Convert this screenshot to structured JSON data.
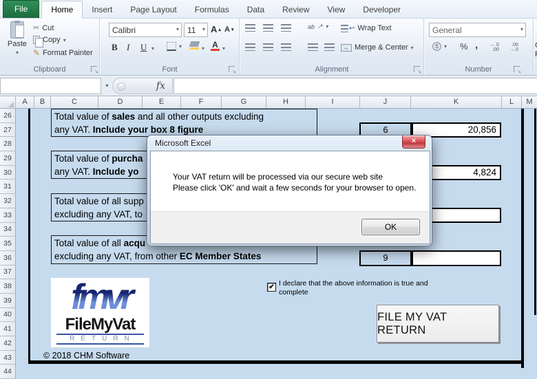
{
  "ribbon": {
    "tabs": [
      {
        "label": "File"
      },
      {
        "label": "Home"
      },
      {
        "label": "Insert"
      },
      {
        "label": "Page Layout"
      },
      {
        "label": "Formulas"
      },
      {
        "label": "Data"
      },
      {
        "label": "Review"
      },
      {
        "label": "View"
      },
      {
        "label": "Developer"
      }
    ],
    "clipboard": {
      "group_label": "Clipboard",
      "paste": "Paste",
      "cut": "Cut",
      "copy": "Copy",
      "format_painter": "Format Painter"
    },
    "font": {
      "group_label": "Font",
      "font_name": "Calibri",
      "font_size": "11",
      "bold": "B",
      "italic": "I",
      "underline": "U",
      "grow": "A",
      "shrink": "A",
      "font_color_letter": "A"
    },
    "alignment": {
      "group_label": "Alignment",
      "wrap_text": "Wrap Text",
      "merge_center": "Merge & Center",
      "orientation": "ab"
    },
    "number": {
      "group_label": "Number",
      "format": "General",
      "percent": "%",
      "comma": ",",
      "inc1": "←.0",
      "inc2": ".00",
      "dec1": ".00",
      "dec2": "→.0"
    },
    "styles_clipped_line1": "Co",
    "styles_clipped_line2": "Fo"
  },
  "icons": {
    "dropdown": "▾",
    "up_arrow": "▴",
    "scissors": "✂",
    "brush": "✎",
    "orient_arrow": "↗",
    "wrap_arrow": "↩",
    "merge_arrows": "↔",
    "launcher_arrow": "↘",
    "check": "✔",
    "close": "×",
    "fx": "fx",
    "currency": "$"
  },
  "formula_bar": {
    "name_box": ""
  },
  "grid": {
    "columns": [
      "A",
      "B",
      "C",
      "D",
      "E",
      "F",
      "G",
      "H",
      "I",
      "J",
      "K",
      "L",
      "M"
    ],
    "rows": [
      "26",
      "27",
      "28",
      "29",
      "30",
      "31",
      "32",
      "33",
      "34",
      "35",
      "36",
      "37",
      "38",
      "39",
      "40",
      "41",
      "42",
      "43",
      "44"
    ]
  },
  "form": {
    "boxes": [
      {
        "line1_pre": "Total value of ",
        "line1_bold": "sales",
        "line1_post": " and all other outputs excluding",
        "line2_pre": "any VAT. ",
        "line2_bold": "Include your box 8 figure",
        "line2_post": "",
        "box_no": "6",
        "value": "20,856"
      },
      {
        "line1_pre": "Total value of ",
        "line1_bold": "purcha",
        "line1_post": "",
        "line2_pre": "any VAT. ",
        "line2_bold": "Include yo",
        "line2_post": "",
        "box_no": "",
        "value": "4,824"
      },
      {
        "line1_pre": "Total value of all supp",
        "line1_bold": "",
        "line1_post": "",
        "line2_pre": "excluding any VAT, to",
        "line2_bold": "",
        "line2_post": "",
        "box_no": "",
        "value": ""
      },
      {
        "line1_pre": "Total value of all ",
        "line1_bold": "acqu",
        "line1_post": "",
        "line2_pre": "excluding any VAT, from other ",
        "line2_bold": "EC Member States",
        "line2_post": "",
        "box_no": "9",
        "value": ""
      }
    ],
    "declaration_line1": "I declare that the above information is true and",
    "declaration_line2": "complete",
    "file_button": "FILE MY VAT RETURN",
    "copyright": "© 2018 CHM Software",
    "logo": {
      "mark": "fmvr",
      "name": "FileMyVat",
      "sub": "RETURN"
    }
  },
  "dialog": {
    "title": "Microsoft Excel",
    "message_line1": "Your VAT return will be processed via our secure web site",
    "message_line2": "Please click 'OK' and wait a few seconds for your browser to open.",
    "ok": "OK"
  },
  "colors": {
    "accent_green": "#1E7145",
    "sheet_blue": "#c6dbee",
    "close_red": "#c13b42"
  }
}
